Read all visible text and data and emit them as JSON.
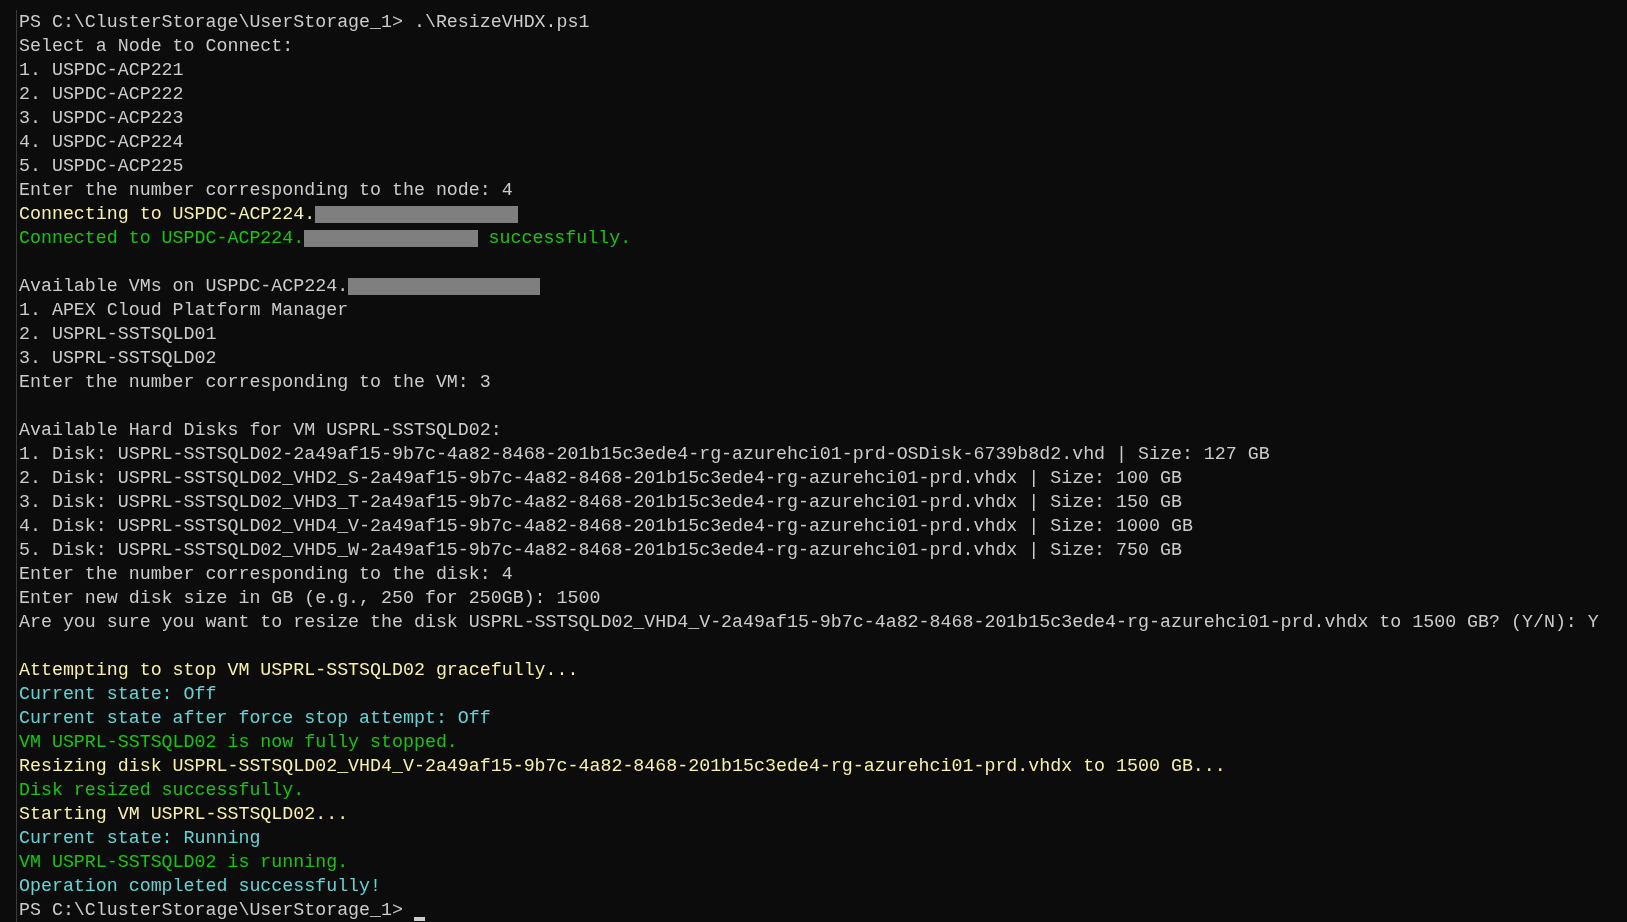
{
  "lines": [
    {
      "kind": "prompt",
      "text": "PS C:\\ClusterStorage\\UserStorage_1> .\\ResizeVHDX.ps1",
      "color": "#cccccc",
      "cursor": false
    },
    {
      "kind": "text",
      "color": "#cccccc",
      "segments": [
        {
          "kind": "text",
          "text": "Select a Node to Connect:"
        }
      ]
    },
    {
      "kind": "text",
      "color": "#cccccc",
      "segments": [
        {
          "kind": "text",
          "text": "1. USPDC-ACP221"
        }
      ]
    },
    {
      "kind": "text",
      "color": "#cccccc",
      "segments": [
        {
          "kind": "text",
          "text": "2. USPDC-ACP222"
        }
      ]
    },
    {
      "kind": "text",
      "color": "#cccccc",
      "segments": [
        {
          "kind": "text",
          "text": "3. USPDC-ACP223"
        }
      ]
    },
    {
      "kind": "text",
      "color": "#cccccc",
      "segments": [
        {
          "kind": "text",
          "text": "4. USPDC-ACP224"
        }
      ]
    },
    {
      "kind": "text",
      "color": "#cccccc",
      "segments": [
        {
          "kind": "text",
          "text": "5. USPDC-ACP225"
        }
      ]
    },
    {
      "kind": "text",
      "color": "#cccccc",
      "segments": [
        {
          "kind": "text",
          "text": "Enter the number corresponding to the node: 4"
        }
      ]
    },
    {
      "kind": "text",
      "color": "#f9f1a5",
      "segments": [
        {
          "kind": "text",
          "text": "Connecting to USPDC-ACP224."
        },
        {
          "kind": "redacted"
        }
      ]
    },
    {
      "kind": "text",
      "color": "#16c60c",
      "segments": [
        {
          "kind": "text",
          "text": "Connected to USPDC-ACP224."
        },
        {
          "kind": "redacted"
        },
        {
          "kind": "text",
          "text": " successfully."
        }
      ]
    },
    {
      "kind": "blank"
    },
    {
      "kind": "text",
      "color": "#cccccc",
      "segments": [
        {
          "kind": "text",
          "text": "Available VMs on USPDC-ACP224."
        },
        {
          "kind": "redacted"
        }
      ]
    },
    {
      "kind": "text",
      "color": "#cccccc",
      "segments": [
        {
          "kind": "text",
          "text": "1. APEX Cloud Platform Manager"
        }
      ]
    },
    {
      "kind": "text",
      "color": "#cccccc",
      "segments": [
        {
          "kind": "text",
          "text": "2. USPRL-SSTSQLD01"
        }
      ]
    },
    {
      "kind": "text",
      "color": "#cccccc",
      "segments": [
        {
          "kind": "text",
          "text": "3. USPRL-SSTSQLD02"
        }
      ]
    },
    {
      "kind": "text",
      "color": "#cccccc",
      "segments": [
        {
          "kind": "text",
          "text": "Enter the number corresponding to the VM: 3"
        }
      ]
    },
    {
      "kind": "blank"
    },
    {
      "kind": "text",
      "color": "#cccccc",
      "segments": [
        {
          "kind": "text",
          "text": "Available Hard Disks for VM USPRL-SSTSQLD02:"
        }
      ]
    },
    {
      "kind": "text",
      "color": "#cccccc",
      "segments": [
        {
          "kind": "text",
          "text": "1. Disk: USPRL-SSTSQLD02-2a49af15-9b7c-4a82-8468-201b15c3ede4-rg-azurehci01-prd-OSDisk-6739b8d2.vhd | Size: 127 GB"
        }
      ]
    },
    {
      "kind": "text",
      "color": "#cccccc",
      "segments": [
        {
          "kind": "text",
          "text": "2. Disk: USPRL-SSTSQLD02_VHD2_S-2a49af15-9b7c-4a82-8468-201b15c3ede4-rg-azurehci01-prd.vhdx | Size: 100 GB"
        }
      ]
    },
    {
      "kind": "text",
      "color": "#cccccc",
      "segments": [
        {
          "kind": "text",
          "text": "3. Disk: USPRL-SSTSQLD02_VHD3_T-2a49af15-9b7c-4a82-8468-201b15c3ede4-rg-azurehci01-prd.vhdx | Size: 150 GB"
        }
      ]
    },
    {
      "kind": "text",
      "color": "#cccccc",
      "segments": [
        {
          "kind": "text",
          "text": "4. Disk: USPRL-SSTSQLD02_VHD4_V-2a49af15-9b7c-4a82-8468-201b15c3ede4-rg-azurehci01-prd.vhdx | Size: 1000 GB"
        }
      ]
    },
    {
      "kind": "text",
      "color": "#cccccc",
      "segments": [
        {
          "kind": "text",
          "text": "5. Disk: USPRL-SSTSQLD02_VHD5_W-2a49af15-9b7c-4a82-8468-201b15c3ede4-rg-azurehci01-prd.vhdx | Size: 750 GB"
        }
      ]
    },
    {
      "kind": "text",
      "color": "#cccccc",
      "segments": [
        {
          "kind": "text",
          "text": "Enter the number corresponding to the disk: 4"
        }
      ]
    },
    {
      "kind": "text",
      "color": "#cccccc",
      "segments": [
        {
          "kind": "text",
          "text": "Enter new disk size in GB (e.g., 250 for 250GB): 1500"
        }
      ]
    },
    {
      "kind": "text",
      "color": "#cccccc",
      "segments": [
        {
          "kind": "text",
          "text": "Are you sure you want to resize the disk USPRL-SSTSQLD02_VHD4_V-2a49af15-9b7c-4a82-8468-201b15c3ede4-rg-azurehci01-prd.vhdx to 1500 GB? (Y/N): Y"
        }
      ]
    },
    {
      "kind": "blank"
    },
    {
      "kind": "text",
      "color": "#f9f1a5",
      "segments": [
        {
          "kind": "text",
          "text": "Attempting to stop VM USPRL-SSTSQLD02 gracefully..."
        }
      ]
    },
    {
      "kind": "text",
      "color": "#61d6d6",
      "segments": [
        {
          "kind": "text",
          "text": "Current state: Off"
        }
      ]
    },
    {
      "kind": "text",
      "color": "#61d6d6",
      "segments": [
        {
          "kind": "text",
          "text": "Current state after force stop attempt: Off"
        }
      ]
    },
    {
      "kind": "text",
      "color": "#16c60c",
      "segments": [
        {
          "kind": "text",
          "text": "VM USPRL-SSTSQLD02 is now fully stopped."
        }
      ]
    },
    {
      "kind": "text",
      "color": "#f9f1a5",
      "segments": [
        {
          "kind": "text",
          "text": "Resizing disk USPRL-SSTSQLD02_VHD4_V-2a49af15-9b7c-4a82-8468-201b15c3ede4-rg-azurehci01-prd.vhdx to 1500 GB..."
        }
      ]
    },
    {
      "kind": "text",
      "color": "#16c60c",
      "segments": [
        {
          "kind": "text",
          "text": "Disk resized successfully."
        }
      ]
    },
    {
      "kind": "text",
      "color": "#f9f1a5",
      "segments": [
        {
          "kind": "text",
          "text": "Starting VM USPRL-SSTSQLD02..."
        }
      ]
    },
    {
      "kind": "text",
      "color": "#61d6d6",
      "segments": [
        {
          "kind": "text",
          "text": "Current state: Running"
        }
      ]
    },
    {
      "kind": "text",
      "color": "#16c60c",
      "segments": [
        {
          "kind": "text",
          "text": "VM USPRL-SSTSQLD02 is running."
        }
      ]
    },
    {
      "kind": "text",
      "color": "#61d6d6",
      "segments": [
        {
          "kind": "text",
          "text": "Operation completed successfully!"
        }
      ]
    },
    {
      "kind": "prompt",
      "text": "PS C:\\ClusterStorage\\UserStorage_1>",
      "color": "#cccccc",
      "cursor": true
    }
  ]
}
